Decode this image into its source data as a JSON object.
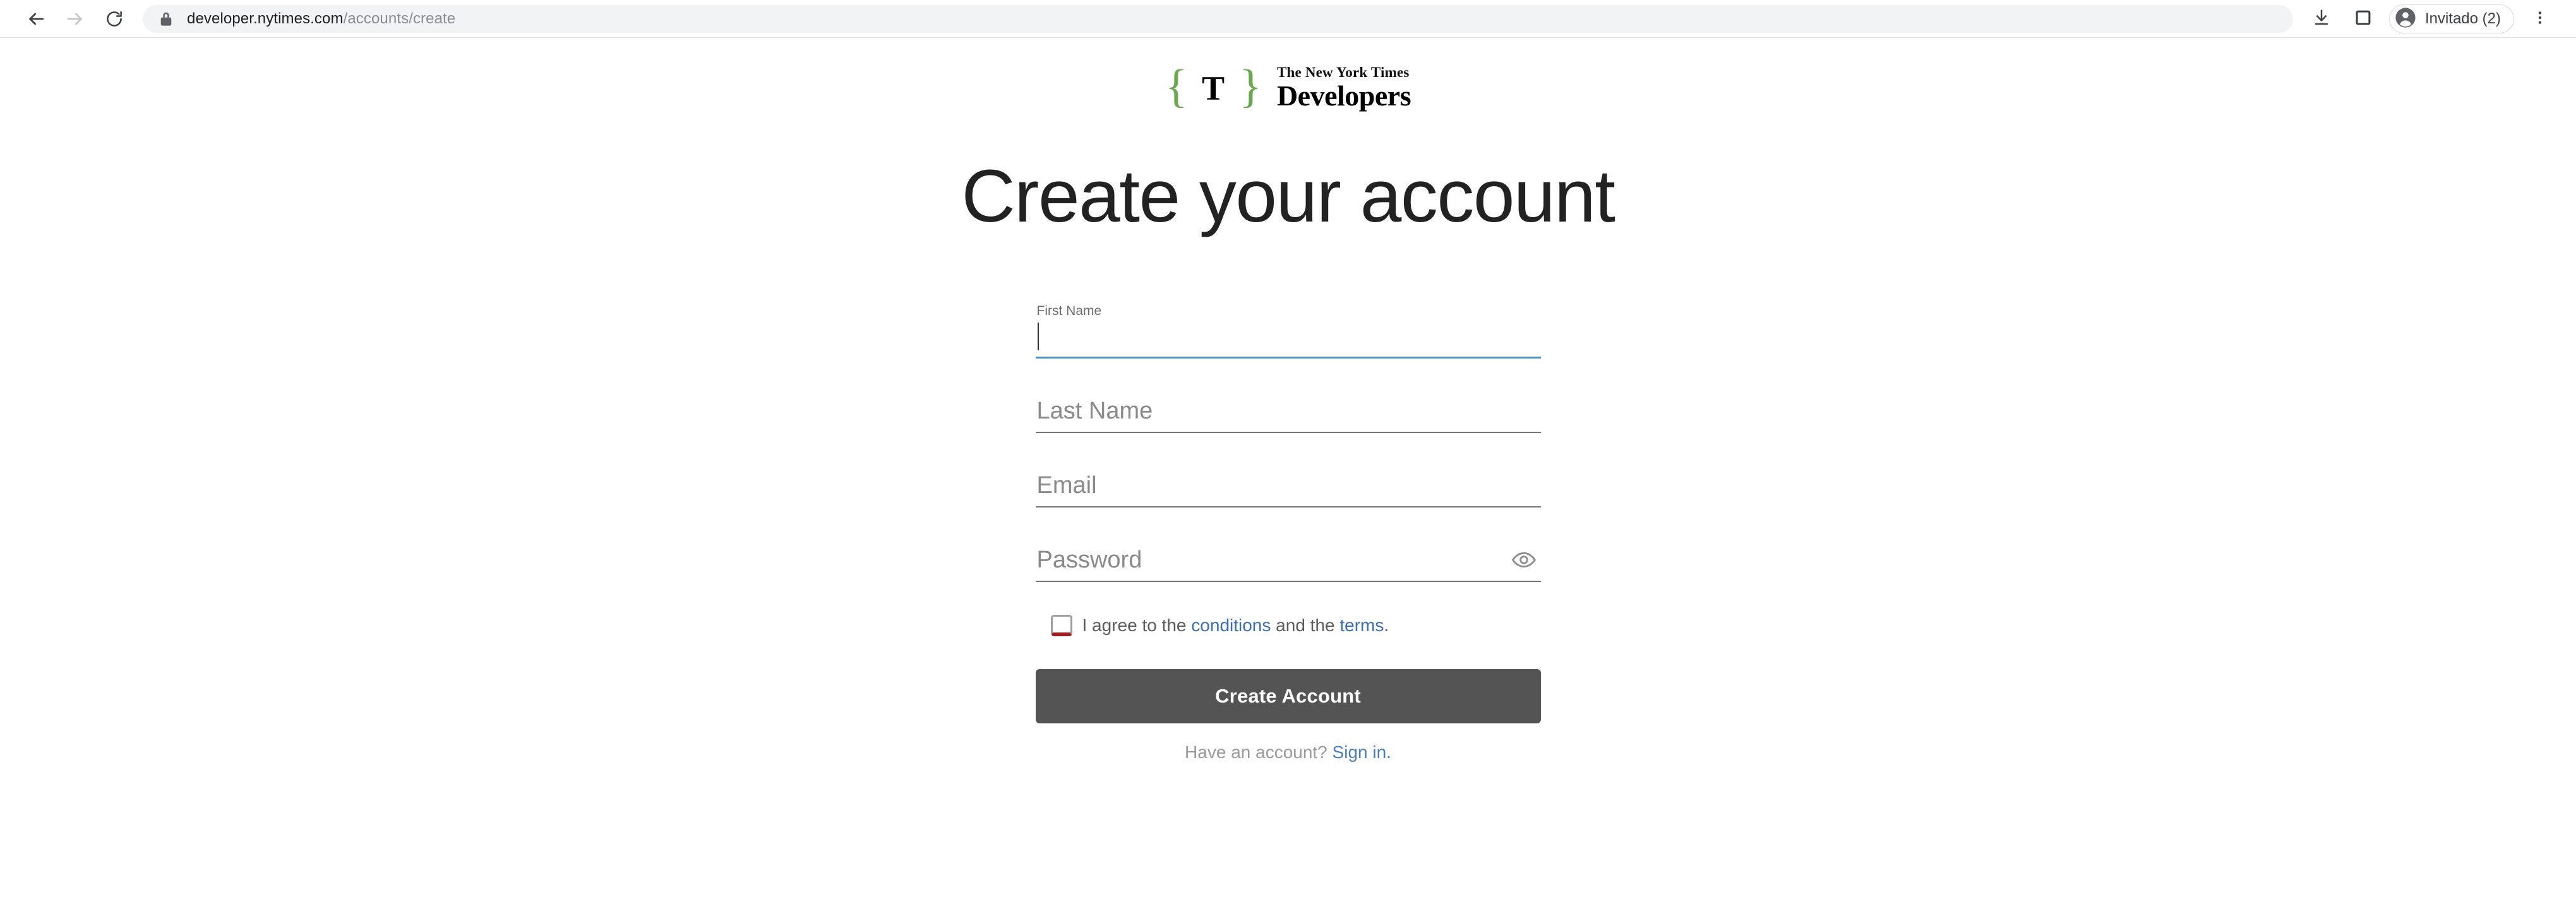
{
  "browser": {
    "back_icon": "arrow-left-icon",
    "forward_icon": "arrow-right-icon",
    "reload_icon": "reload-icon",
    "lock_icon": "lock-icon",
    "url_domain": "developer.nytimes.com",
    "url_path": "/accounts/create",
    "url_full": "developer.nytimes.com/accounts/create",
    "download_icon": "download-icon",
    "side_panel_icon": "side-panel-icon",
    "profile_icon": "account-circle-icon",
    "profile_label": "Invitado (2)",
    "menu_icon": "three-dot-menu-icon"
  },
  "logo": {
    "brace_open": "{",
    "brace_close": "}",
    "monogram": "T",
    "masthead": "The New York Times",
    "product": "Developers",
    "brace_color": "#6aa84f"
  },
  "page": {
    "title": "Create your account"
  },
  "form": {
    "fields": [
      {
        "name": "first_name",
        "label": "First Name",
        "placeholder": "First Name",
        "value": "",
        "focused": true
      },
      {
        "name": "last_name",
        "label": "Last Name",
        "placeholder": "Last Name",
        "value": "",
        "focused": false
      },
      {
        "name": "email",
        "label": "Email",
        "placeholder": "Email",
        "value": "",
        "focused": false
      },
      {
        "name": "password",
        "label": "Password",
        "placeholder": "Password",
        "value": "",
        "focused": false
      }
    ],
    "password_toggle_icon": "eye-icon",
    "terms": {
      "checked": false,
      "invalid": true,
      "prefix": "I agree to the ",
      "conditions_link": "conditions",
      "middle": " and the ",
      "terms_link": "terms",
      "suffix": "."
    },
    "submit_label": "Create Account",
    "signin_prompt": "Have an account? ",
    "signin_link": "Sign in."
  },
  "colors": {
    "focus_underline": "#4a90c9",
    "idle_underline": "#757575",
    "link_blue": "#3c6fb0",
    "button_bg": "#545454",
    "checkbox_error": "#9c1f1f",
    "brand_green": "#6aa84f"
  }
}
